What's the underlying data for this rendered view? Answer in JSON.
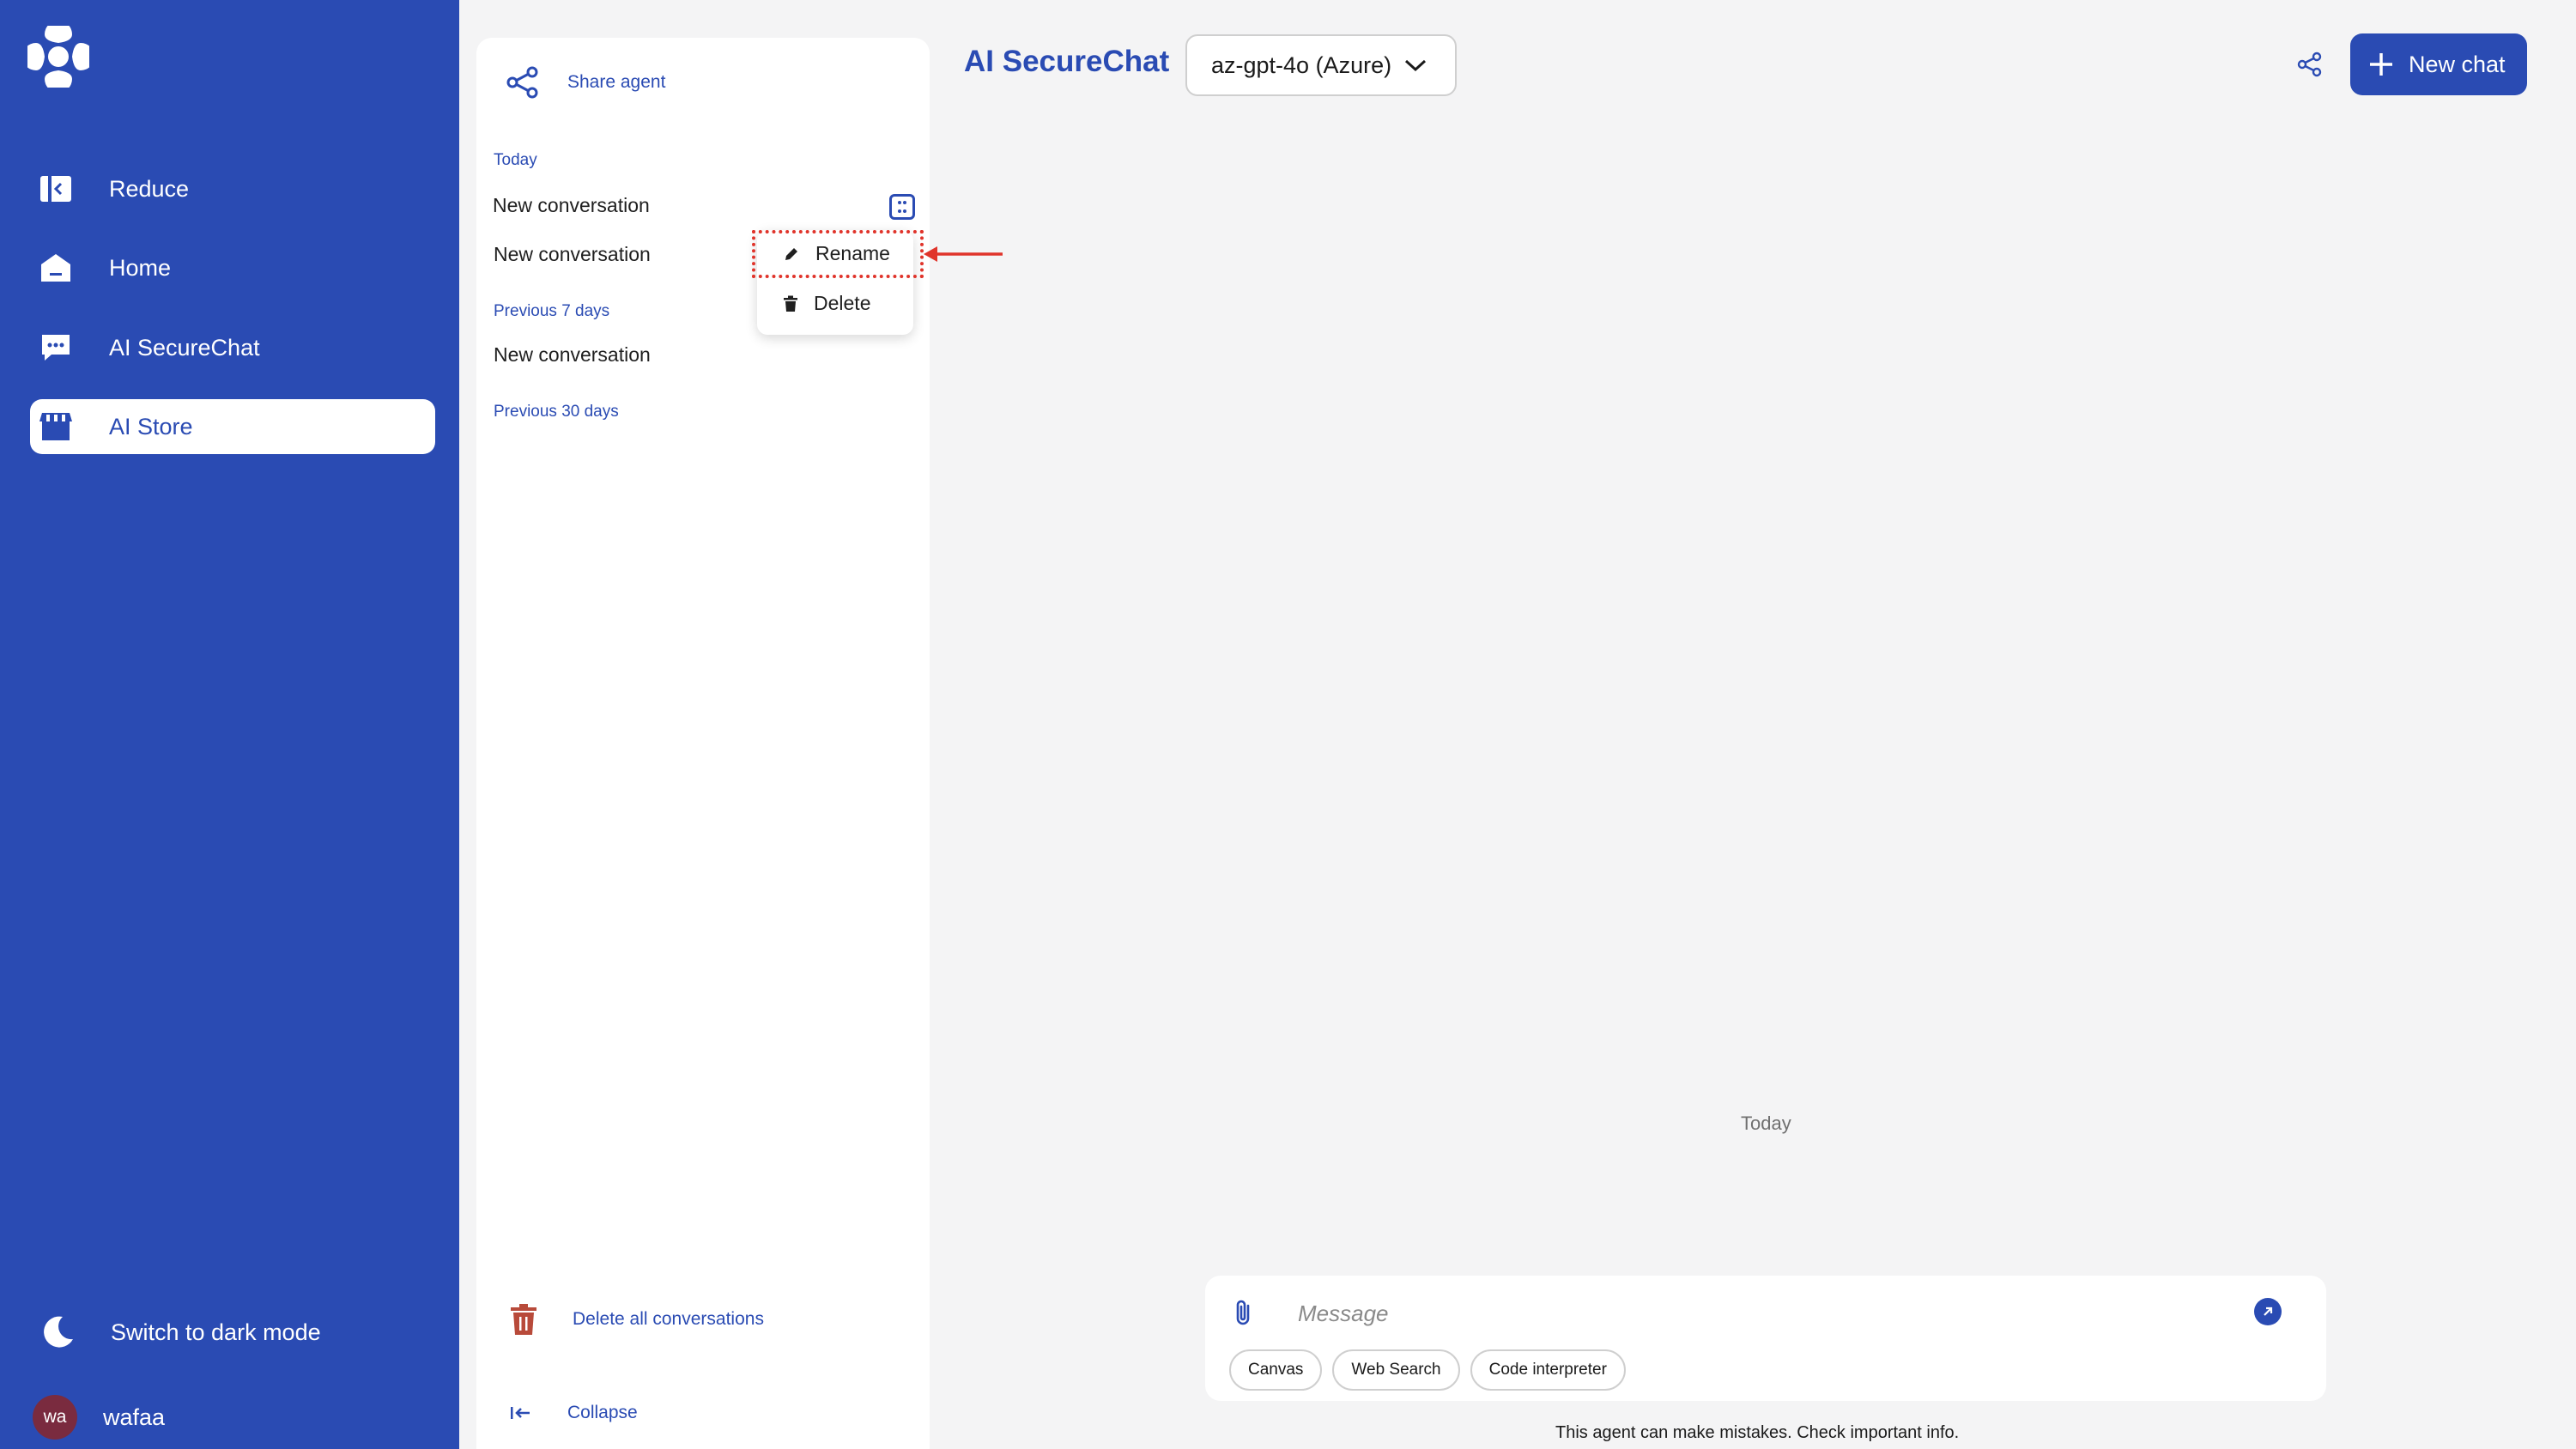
{
  "nav": {
    "items": [
      {
        "label": "Reduce",
        "icon": "sidebar-collapse-icon"
      },
      {
        "label": "Home",
        "icon": "home-icon"
      },
      {
        "label": "AI SecureChat",
        "icon": "chat-bubble-icon"
      },
      {
        "label": "AI Store",
        "icon": "store-icon",
        "active": true
      }
    ],
    "dark_mode_label": "Switch to dark mode",
    "user": {
      "initials": "wa",
      "name": "wafaa"
    }
  },
  "conversations": {
    "share_agent_label": "Share agent",
    "sections": {
      "today": "Today",
      "previous_7": "Previous 7 days",
      "previous_30": "Previous 30 days"
    },
    "today_items": [
      "New conversation",
      "New conversation"
    ],
    "previous_7_items": [
      "New conversation"
    ],
    "context_menu": {
      "rename": "Rename",
      "delete": "Delete"
    },
    "delete_all_label": "Delete all conversations",
    "collapse_label": "Collapse"
  },
  "header": {
    "title": "AI SecureChat",
    "model": "az-gpt-4o (Azure)",
    "new_chat_label": "New chat"
  },
  "chat": {
    "day_label": "Today",
    "message_placeholder": "Message",
    "chips": [
      "Canvas",
      "Web Search",
      "Code interpreter"
    ],
    "disclaimer": "This agent can make mistakes. Check important info."
  },
  "colors": {
    "brand": "#2a4bb3",
    "annotation": "#e0342b",
    "delete": "#b84a3a"
  }
}
